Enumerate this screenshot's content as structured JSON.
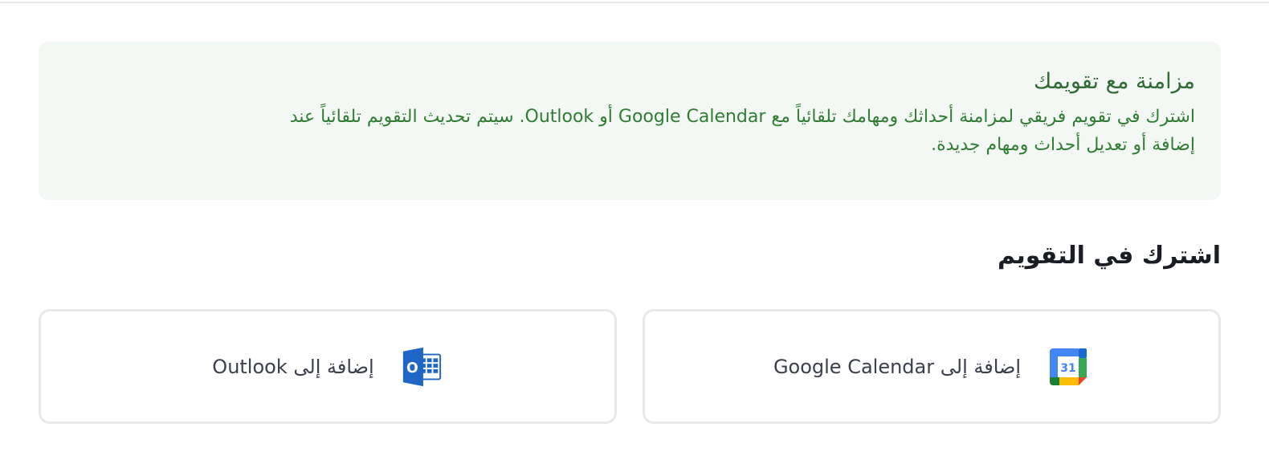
{
  "info": {
    "title": "مزامنة مع تقويمك",
    "line1": "اشترك في تقويم فريقي لمزامنة أحداثك ومهامك تلقائياً مع Google Calendar أو Outlook. سيتم تحديث التقويم تلقائياً عند",
    "line2": "إضافة أو تعديل أحداث ومهام جديدة."
  },
  "section": {
    "title": "اشترك في التقويم"
  },
  "cards": {
    "google": {
      "label": "إضافة إلى Google Calendar",
      "icon": "google-calendar-icon",
      "icon_text": "31"
    },
    "outlook": {
      "label": "إضافة إلى Outlook",
      "icon": "outlook-icon",
      "icon_text": "O"
    }
  },
  "colors": {
    "info_bg": "#f4f8f5",
    "info_text": "#2e7d32",
    "card_border": "#e6e8ec",
    "google_blue": "#4285f4",
    "outlook_blue": "#0f6cbd"
  }
}
